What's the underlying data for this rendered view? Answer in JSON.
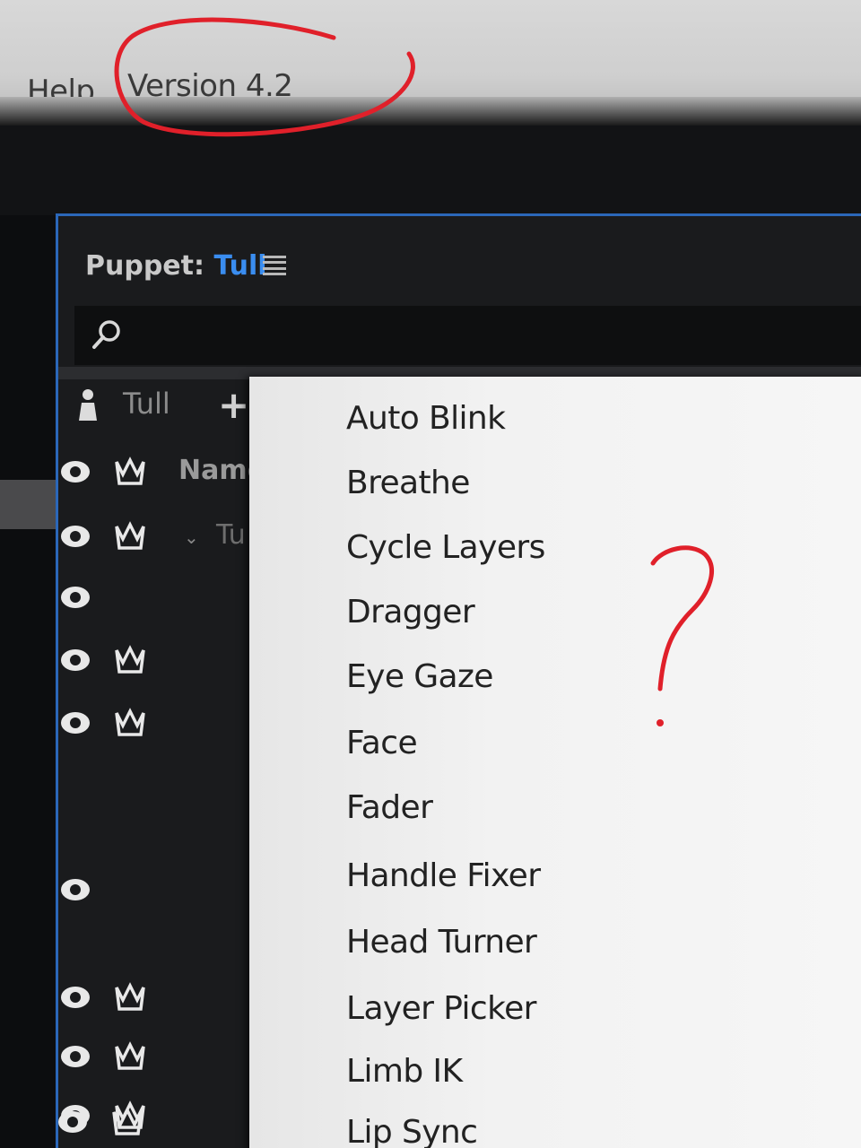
{
  "menubar": {
    "help_label": "Help",
    "version_label": "Version 4.2"
  },
  "panel": {
    "header_prefix": "Puppet:",
    "puppet_name": "Tull",
    "root_label": "Tull",
    "add_label": "+",
    "name_column": "Name",
    "child_label": "Tu"
  },
  "behaviors_menu": {
    "items": [
      "Auto Blink",
      "Breathe",
      "Cycle Layers",
      "Dragger",
      "Eye Gaze",
      "Face",
      "Fader",
      "Handle Fixer",
      "Head Turner",
      "Layer Picker",
      "Limb IK",
      "Lip Sync"
    ]
  },
  "annotations": {
    "mark": "?",
    "color": "#e0202a"
  },
  "colors": {
    "accent": "#3a8df0",
    "panel_border": "#2b67b9"
  }
}
